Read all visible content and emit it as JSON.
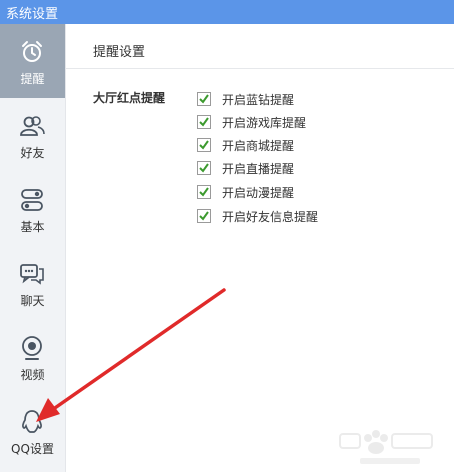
{
  "window": {
    "title": "系统设置"
  },
  "sidebar": {
    "items": [
      {
        "label": "提醒",
        "icon": "alarm-clock-icon",
        "active": true
      },
      {
        "label": "好友",
        "icon": "friends-icon",
        "active": false
      },
      {
        "label": "基本",
        "icon": "toggle-switches-icon",
        "active": false
      },
      {
        "label": "聊天",
        "icon": "chat-bubbles-icon",
        "active": false
      },
      {
        "label": "视频",
        "icon": "webcam-icon",
        "active": false
      },
      {
        "label": "QQ设置",
        "icon": "qq-penguin-icon",
        "active": false
      }
    ]
  },
  "main": {
    "section_title": "提醒设置",
    "group_label": "大厅红点提醒",
    "options": [
      {
        "label": "开启蓝钻提醒",
        "checked": true
      },
      {
        "label": "开启游戏库提醒",
        "checked": true
      },
      {
        "label": "开启商城提醒",
        "checked": true
      },
      {
        "label": "开启直播提醒",
        "checked": true
      },
      {
        "label": "开启动漫提醒",
        "checked": true
      },
      {
        "label": "开启好友信息提醒",
        "checked": true
      }
    ]
  },
  "colors": {
    "titlebar": "#5b95e8",
    "active_sidebar": "#9aa6b4",
    "checkmark": "#3c9a2e",
    "annotation_arrow": "#e02a2a"
  }
}
